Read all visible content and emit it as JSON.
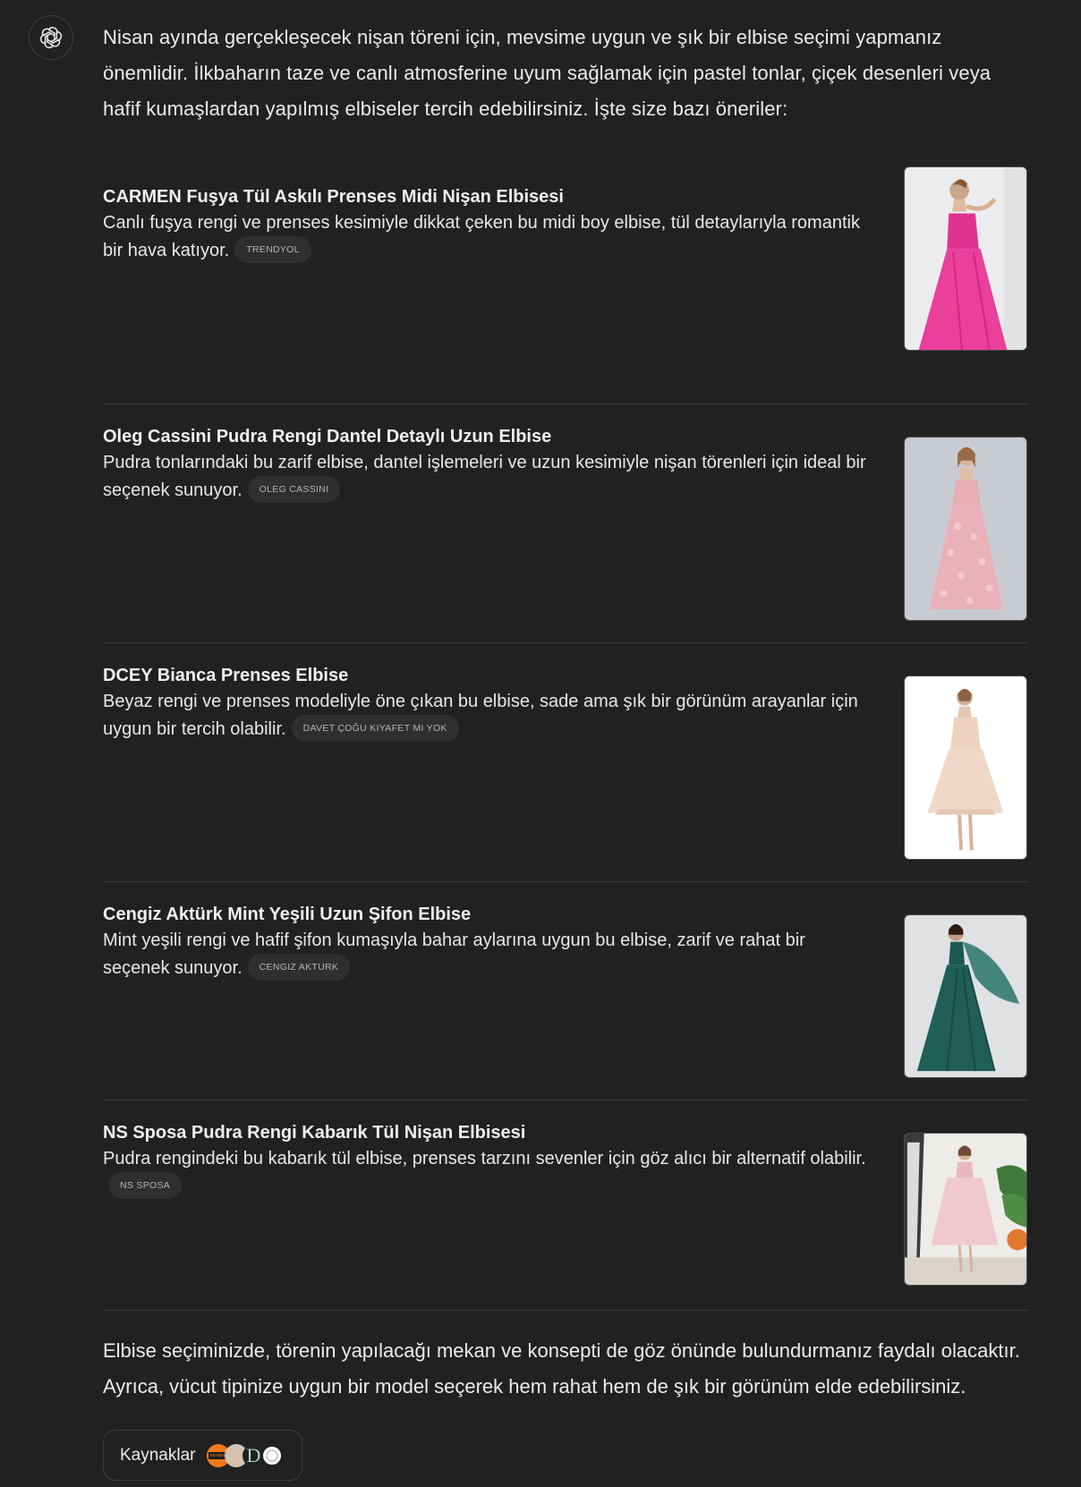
{
  "assistant": {
    "avatar_icon": "openai-logo-icon"
  },
  "intro": "Nisan ayında gerçekleşecek nişan töreni için, mevsime uygun ve şık bir elbise seçimi yapmanız önemlidir. İlkbaharın taze ve canlı atmosferine uyum sağlamak için pastel tonlar, çiçek desenleri veya hafif kumaşlardan yapılmış elbiseler tercih edebilirsiniz. İşte size bazı öneriler:",
  "products": [
    {
      "name": "CARMEN Fuşya Tül Askılı Prenses Midi Nişan Elbisesi",
      "description": "Canlı fuşya rengi ve prenses kesimiyle dikkat çeken bu midi boy elbise, tül detaylarıyla romantik bir hava katıyor.",
      "source": "TRENDYOL",
      "image_icon": "fuchsia-dress-photo"
    },
    {
      "name": "Oleg Cassini Pudra Rengi Dantel Detaylı Uzun Elbise",
      "description": "Pudra tonlarındaki bu zarif elbise, dantel işlemeleri ve uzun kesimiyle nişan törenleri için ideal bir seçenek sunuyor.",
      "source": "OLEG CASSINI",
      "image_icon": "powder-lace-dress-photo"
    },
    {
      "name": "DCEY Bianca Prenses Elbise",
      "description": "Beyaz rengi ve prenses modeliyle öne çıkan bu elbise, sade ama şık bir görünüm arayanlar için uygun bir tercih olabilir.",
      "source": "DAVET ÇOĞU KIYAFET MI YOK",
      "image_icon": "nude-princess-dress-photo"
    },
    {
      "name": "Cengiz Aktürk Mint Yeşili Uzun Şifon Elbise",
      "description": "Mint yeşili rengi ve hafif şifon kumaşıyla bahar aylarına uygun bu elbise, zarif ve rahat bir seçenek sunuyor.",
      "source": "CENGIZ AKTURK",
      "image_icon": "green-chiffon-dress-photo"
    },
    {
      "name": "NS Sposa Pudra Rengi Kabarık Tül Nişan Elbisesi",
      "description": "Pudra rengindeki bu kabarık tül elbise, prenses tarzını sevenler için göz alıcı bir alternatif olabilir.",
      "source": "NS SPOSA",
      "image_icon": "pink-tulle-dress-photo"
    }
  ],
  "outro": "Elbise seçiminizde, törenin yapılacağı mekan ve konsepti de göz önünde bulundurmanız faydalı olacaktır. Ayrıca, vücut tipinize uygun bir model seçerek hem rahat hem de şık bir görünüm elde edebilirsiniz.",
  "sources_button": {
    "label": "Kaynaklar",
    "favicons": [
      "trendyol-favicon",
      "olegcassini-favicon",
      "d-favicon",
      "white-circle-favicon"
    ],
    "favicon_letter": "D",
    "trendyol_text": "trendyol"
  },
  "colors": {
    "background": "#212121",
    "text": "#ececec",
    "pill_bg": "#2f2f2f",
    "divider": "#3a3a3a"
  }
}
